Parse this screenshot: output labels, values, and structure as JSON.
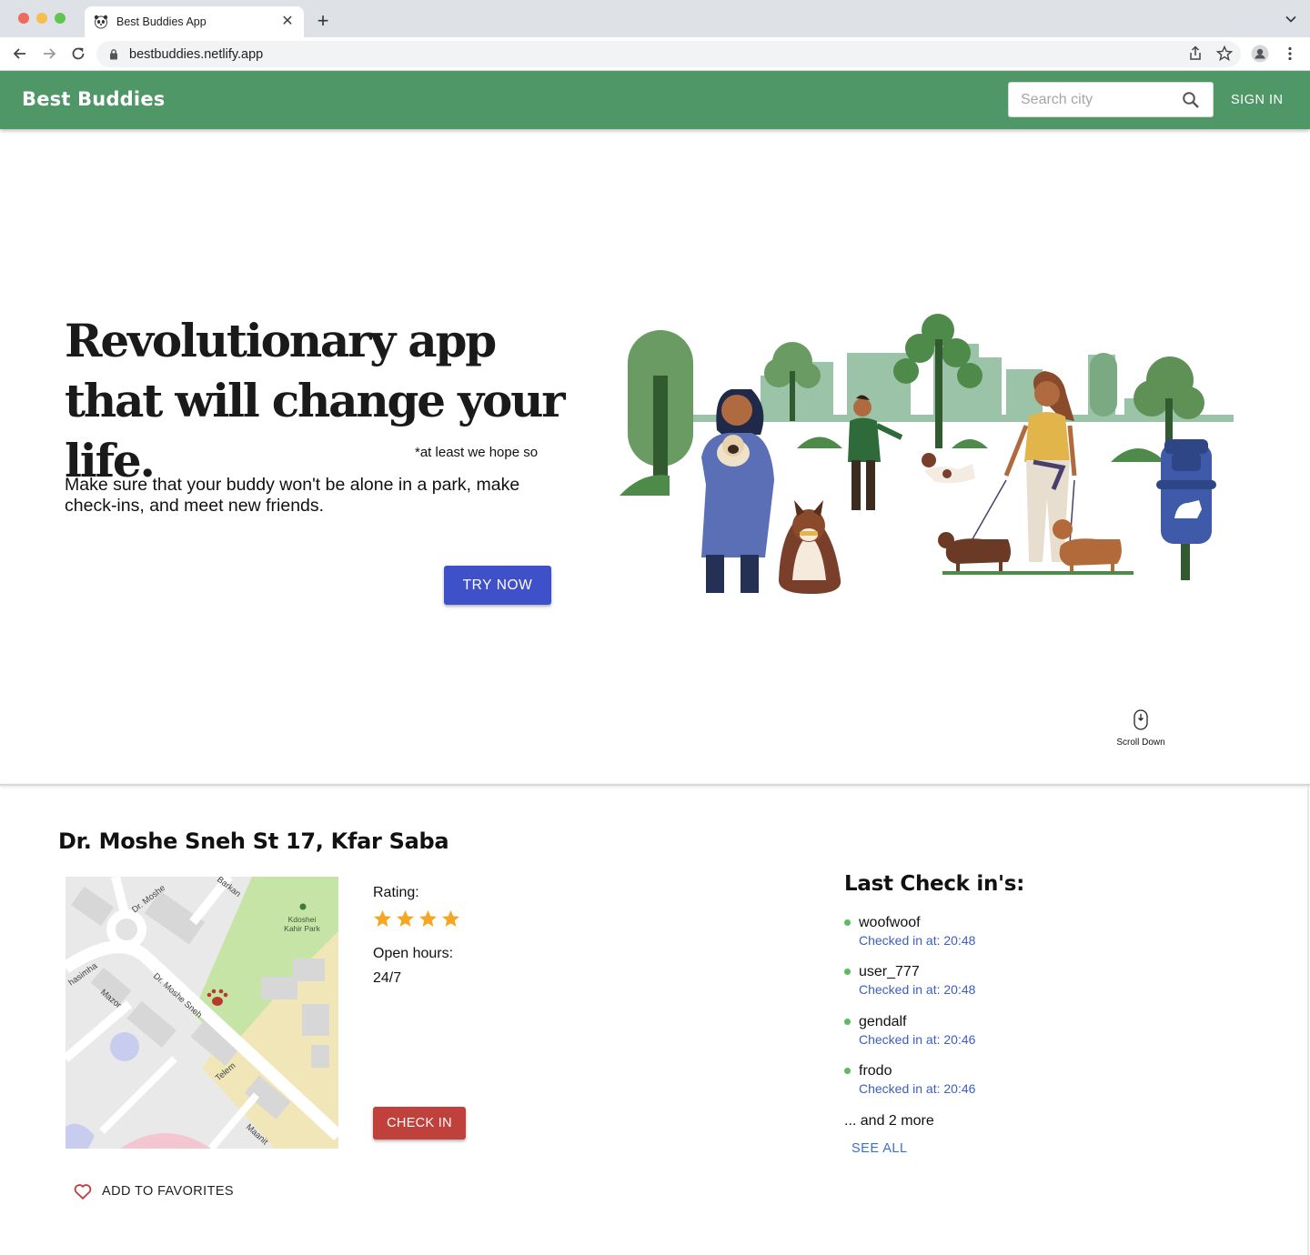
{
  "browser": {
    "tab_title": "Best Buddies App",
    "url": "bestbuddies.netlify.app"
  },
  "header": {
    "brand": "Best Buddies",
    "search_placeholder": "Search city",
    "sign_in": "SIGN IN",
    "color": "#4f9767"
  },
  "hero": {
    "title": "Revolutionary app that will change your life.",
    "hope_note": "*at least we hope so",
    "subtitle": "Make sure that your buddy won't be alone in a park, make check-ins, and meet new friends.",
    "cta": "TRY NOW",
    "scroll_hint": "Scroll Down"
  },
  "park": {
    "address": "Dr. Moshe Sneh St 17, Kfar Saba",
    "rating_label": "Rating:",
    "rating": 4,
    "hours_label": "Open hours:",
    "hours": "24/7",
    "check_in": "CHECK IN",
    "add_favorites": "ADD TO FAVORITES",
    "map_labels": {
      "park_name_1": "Kdoshei",
      "park_name_2": "Kahir Park",
      "street_sneh": "Dr. Moshe Sneh",
      "street_moshe": "Dr. Moshe",
      "street_mazor": "Mazor",
      "street_hasimha": "hasimha",
      "street_telem": "Telem",
      "street_barkan": "Barkan",
      "street_maanit": "Maanit"
    }
  },
  "checkins": {
    "title": "Last Check in's:",
    "items": [
      {
        "user": "woofwoof",
        "time": "Checked in at: 20:48"
      },
      {
        "user": "user_777",
        "time": "Checked in at: 20:48"
      },
      {
        "user": "gendalf",
        "time": "Checked in at: 20:46"
      },
      {
        "user": "frodo",
        "time": "Checked in at: 20:46"
      }
    ],
    "more": "... and 2 more",
    "see_all": "SEE ALL"
  }
}
